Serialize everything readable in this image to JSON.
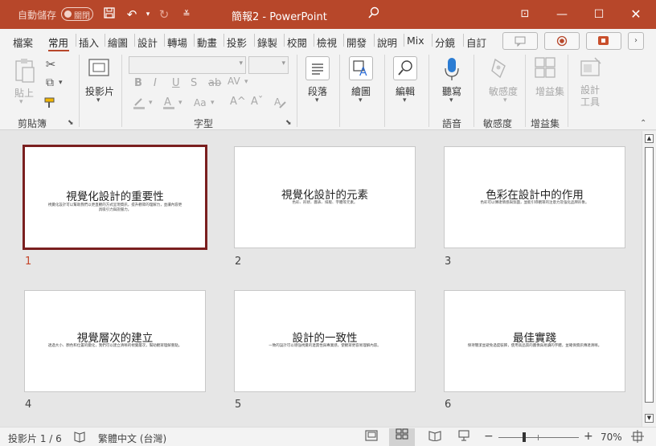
{
  "titlebar": {
    "autosave_label": "自動儲存",
    "autosave_state": "關閉",
    "title": "簡報2 - PowerPoint",
    "icons": [
      "save-icon",
      "undo-icon",
      "redo-icon",
      "customize-qat-icon",
      "search-icon",
      "ribbon-display-icon",
      "minimize-icon",
      "maximize-icon",
      "close-icon"
    ],
    "accent_color": "#b7472a"
  },
  "tabs": [
    {
      "label": "檔案"
    },
    {
      "label": "常用",
      "active": true
    },
    {
      "label": "插入"
    },
    {
      "label": "繪圖"
    },
    {
      "label": "設計"
    },
    {
      "label": "轉場"
    },
    {
      "label": "動畫"
    },
    {
      "label": "投影"
    },
    {
      "label": "錄製"
    },
    {
      "label": "校閱"
    },
    {
      "label": "檢視"
    },
    {
      "label": "開發"
    },
    {
      "label": "說明"
    },
    {
      "label": "Mix"
    },
    {
      "label": "分鏡"
    },
    {
      "label": "自訂"
    }
  ],
  "ribbon": {
    "groups": {
      "clipboard": {
        "label": "剪貼簿",
        "paste": "貼上"
      },
      "slides": {
        "new_slide": "投影片"
      },
      "font": {
        "label": "字型",
        "font_size_placeholder": "",
        "font_name_placeholder": ""
      },
      "paragraph": {
        "label": "段落"
      },
      "drawing": {
        "label": "繪圖"
      },
      "editing": {
        "label": "編輯"
      },
      "voice": {
        "label": "語音",
        "dictate": "聽寫"
      },
      "sensitivity": {
        "label": "敏感度",
        "button": "敏感度"
      },
      "addins": {
        "label": "增益集",
        "button": "增益集"
      },
      "designer": {
        "button": "設計工具"
      }
    }
  },
  "slides": [
    {
      "number": "1",
      "title": "視覺化設計的重要性",
      "body": "視覺化設計可以幫助我們以更直觀的方式呈現資訊，提升觀眾的理解力，並讓內容更具吸引力與說服力。",
      "selected": true
    },
    {
      "number": "2",
      "title": "視覺化設計的元素",
      "body": "色彩、形狀、圖表、排版、字體等元素。",
      "selected": false
    },
    {
      "number": "3",
      "title": "色彩在設計中的作用",
      "body": "色彩可以傳達情感與氛圍，並能引導觀眾的注意力及強化品牌形象。",
      "selected": false
    },
    {
      "number": "4",
      "title": "視覺層次的建立",
      "body": "透過大小、顏色和位置的變化，我們可以建立清晰的視覺層次，幫助觀眾理解重點。",
      "selected": false
    },
    {
      "number": "5",
      "title": "設計的一致性",
      "body": "一致的設計可以增強視覺的連貫性與專業感，使觀眾更容易理解內容。",
      "selected": false
    },
    {
      "number": "6",
      "title": "最佳實踐",
      "body": "保持簡潔並避免過度裝飾，使用高品質的圖像與易讀的字體，並確保資訊傳達清晰。",
      "selected": false
    }
  ],
  "statusbar": {
    "slide_info": "投影片 1 / 6",
    "language": "繁體中文 (台灣)",
    "zoom": "70%",
    "zoom_minus": "−",
    "zoom_plus": "+"
  }
}
